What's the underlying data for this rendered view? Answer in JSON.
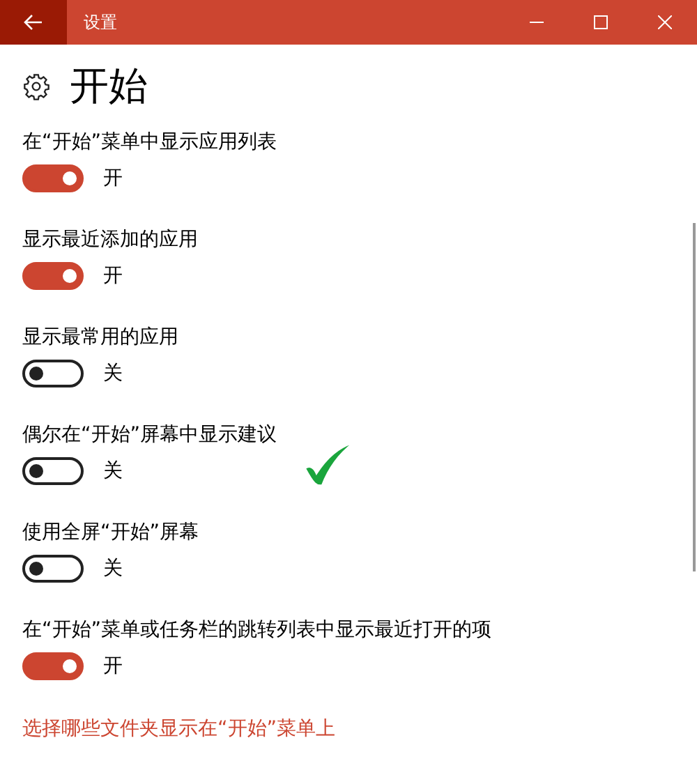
{
  "window": {
    "title": "设置"
  },
  "page": {
    "title": "开始"
  },
  "settings": [
    {
      "label": "在“开始”菜单中显示应用列表",
      "on": true,
      "state_text": "开"
    },
    {
      "label": "显示最近添加的应用",
      "on": true,
      "state_text": "开"
    },
    {
      "label": "显示最常用的应用",
      "on": false,
      "state_text": "关"
    },
    {
      "label": "偶尔在“开始”屏幕中显示建议",
      "on": false,
      "state_text": "关"
    },
    {
      "label": "使用全屏“开始”屏幕",
      "on": false,
      "state_text": "关"
    },
    {
      "label": "在“开始”菜单或任务栏的跳转列表中显示最近打开的项",
      "on": true,
      "state_text": "开"
    }
  ],
  "link": "选择哪些文件夹显示在“开始”菜单上"
}
